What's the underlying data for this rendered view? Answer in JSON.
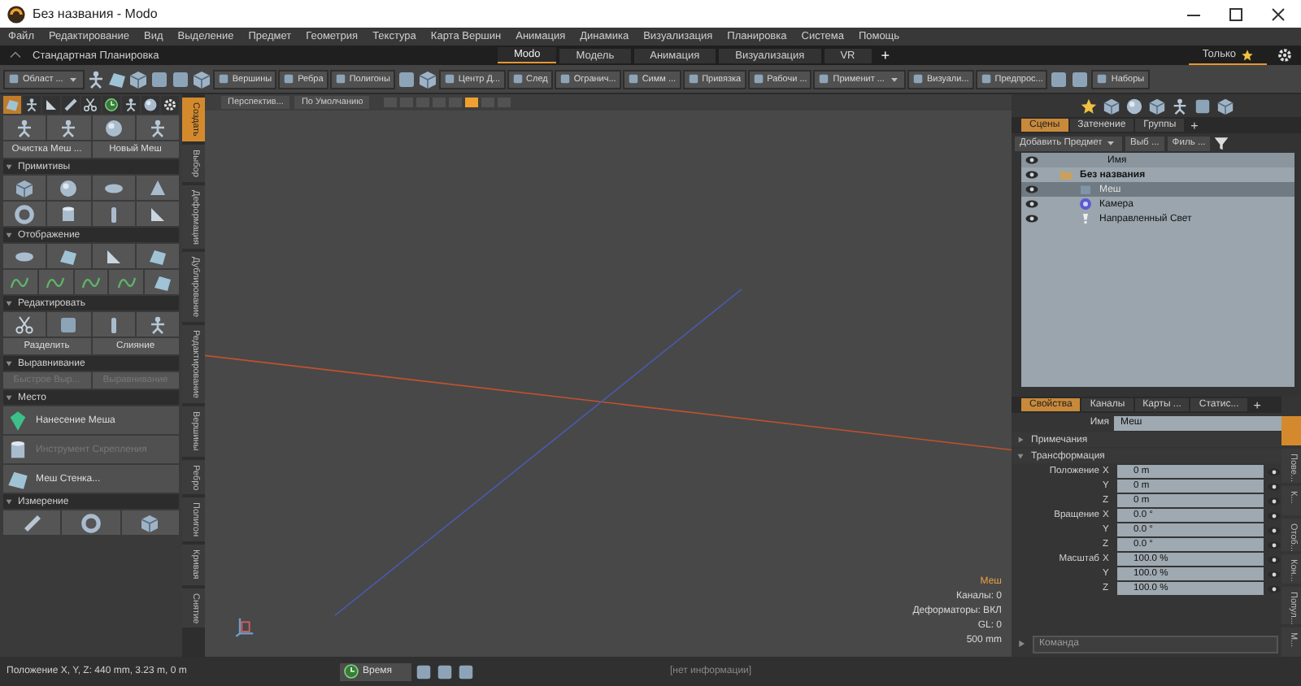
{
  "window": {
    "title": "Без названия - Modo"
  },
  "menu": [
    "Файл",
    "Редактирование",
    "Вид",
    "Выделение",
    "Предмет",
    "Геометрия",
    "Текстура",
    "Карта Вершин",
    "Анимация",
    "Динамика",
    "Визуализация",
    "Планировка",
    "Система",
    "Помощь"
  ],
  "layout_bar": {
    "layout": "Стандартная Планировка",
    "tabs": [
      {
        "label": "Modo",
        "selected": true
      },
      {
        "label": "Модель",
        "selected": false
      },
      {
        "label": "Анимация",
        "selected": false
      },
      {
        "label": "Визуализация",
        "selected": false
      },
      {
        "label": "VR",
        "selected": false
      }
    ],
    "add": "+",
    "user_tab": "Только"
  },
  "toolbar": [
    {
      "kind": "dropdown",
      "label": "Област ..."
    },
    {
      "kind": "icon"
    },
    {
      "kind": "icon"
    },
    {
      "kind": "icon"
    },
    {
      "kind": "icon"
    },
    {
      "kind": "icon"
    },
    {
      "kind": "icon"
    },
    {
      "kind": "button",
      "label": "Вершины"
    },
    {
      "kind": "button",
      "label": "Ребра"
    },
    {
      "kind": "button",
      "label": "Полигоны"
    },
    {
      "kind": "icon"
    },
    {
      "kind": "icon"
    },
    {
      "kind": "button",
      "label": "Центр Д..."
    },
    {
      "kind": "button",
      "label": "След"
    },
    {
      "kind": "button",
      "label": "Огранич..."
    },
    {
      "kind": "button",
      "label": "Симм ..."
    },
    {
      "kind": "button",
      "label": "Привязка"
    },
    {
      "kind": "button",
      "label": "Рабочи ..."
    },
    {
      "kind": "dropdown",
      "label": "Применит ..."
    },
    {
      "kind": "button",
      "label": "Визуали..."
    },
    {
      "kind": "button",
      "label": "Предпрос..."
    },
    {
      "kind": "icon"
    },
    {
      "kind": "icon"
    },
    {
      "kind": "button",
      "label": "Наборы"
    }
  ],
  "left_panel": {
    "top_buttons": [
      "Очистка Меш ...",
      "Новый Меш"
    ],
    "sections": [
      {
        "title": "Примитивы",
        "expanded": true,
        "kind": "icons"
      },
      {
        "title": "Отображение",
        "expanded": true,
        "kind": "icons"
      },
      {
        "title": "Редактировать",
        "expanded": true,
        "kind": "icons",
        "buttons": [
          {
            "label": "Разделить",
            "disabled": false
          },
          {
            "label": "Слияние",
            "disabled": false
          }
        ]
      },
      {
        "title": "Выравнивание",
        "expanded": true,
        "kind": "buttons",
        "buttons": [
          {
            "label": "Быстрое Выр...",
            "disabled": true
          },
          {
            "label": "Выравнивание",
            "disabled": true
          }
        ]
      },
      {
        "title": "Место",
        "expanded": true,
        "kind": "list",
        "buttons": [
          {
            "label": "Нанесение Меша",
            "disabled": false
          },
          {
            "label": "Инструмент Скрепления",
            "disabled": true
          },
          {
            "label": "Меш Стенка...",
            "disabled": false
          }
        ]
      },
      {
        "title": "Измерение",
        "expanded": true,
        "kind": "icons"
      }
    ]
  },
  "side_tabs": [
    {
      "label": "Создать",
      "selected": true
    },
    {
      "label": "Выбор",
      "selected": false
    },
    {
      "label": "Деформация",
      "selected": false
    },
    {
      "label": "Дублирование",
      "selected": false
    },
    {
      "label": "Редактирование",
      "selected": false
    },
    {
      "label": "Вершины",
      "selected": false
    },
    {
      "label": "Ребро",
      "selected": false
    },
    {
      "label": "Полигон",
      "selected": false
    },
    {
      "label": "Кривая",
      "selected": false
    },
    {
      "label": "Снятие",
      "selected": false
    }
  ],
  "viewport": {
    "view_buttons": [
      "Перспектив...",
      "По Умолчанию"
    ],
    "info": [
      {
        "text": "Меш",
        "kind": "title"
      },
      {
        "text": "Каналы: 0",
        "kind": "line"
      },
      {
        "text": "Деформаторы: ВКЛ",
        "kind": "line"
      },
      {
        "text": "GL: 0",
        "kind": "line"
      },
      {
        "text": "500 mm",
        "kind": "line"
      }
    ]
  },
  "scene": {
    "tabs": [
      {
        "label": "Сцены",
        "selected": true
      },
      {
        "label": "Затенение",
        "selected": false
      },
      {
        "label": "Группы",
        "selected": false
      }
    ],
    "add": "+",
    "add_item": "Добавить Предмет",
    "filters": [
      "Выб ...",
      "Филь ..."
    ],
    "column": "Имя",
    "tree": [
      {
        "name": "Без названия",
        "selected": false,
        "children": [
          {
            "name": "Меш",
            "selected": true
          },
          {
            "name": "Камера",
            "selected": false
          },
          {
            "name": "Направленный Свет",
            "selected": false
          }
        ]
      }
    ]
  },
  "properties": {
    "tabs": [
      {
        "label": "Свойства",
        "selected": true
      },
      {
        "label": "Каналы",
        "selected": false
      },
      {
        "label": "Карты ...",
        "selected": false
      },
      {
        "label": "Статис...",
        "selected": false
      }
    ],
    "add": "+",
    "name_label": "Имя",
    "name_value": "Меш",
    "sections": [
      {
        "title": "Примечания",
        "expanded": false
      },
      {
        "title": "Трансформация",
        "expanded": true
      }
    ],
    "groups": [
      {
        "label": "Положение",
        "fields": [
          {
            "axis": "X",
            "value": "0 m"
          },
          {
            "axis": "Y",
            "value": "0 m"
          },
          {
            "axis": "Z",
            "value": "0 m"
          }
        ]
      },
      {
        "label": "Вращение",
        "fields": [
          {
            "axis": "X",
            "value": "0.0 °"
          },
          {
            "axis": "Y",
            "value": "0.0 °"
          },
          {
            "axis": "Z",
            "value": "0.0 °"
          }
        ]
      },
      {
        "label": "Масштаб",
        "fields": [
          {
            "axis": "X",
            "value": "100.0 %"
          },
          {
            "axis": "Y",
            "value": "100.0 %"
          },
          {
            "axis": "Z",
            "value": "100.0 %"
          }
        ]
      }
    ],
    "side_tabs": [
      {
        "selected": true
      },
      {
        "label": "Пове...",
        "selected": false
      },
      {
        "label": "К...",
        "selected": false
      },
      {
        "label": "Отоб...",
        "selected": false
      },
      {
        "label": "Кон...",
        "selected": false
      },
      {
        "label": "Попул...",
        "selected": false
      },
      {
        "label": "М...",
        "selected": false
      }
    ],
    "command_placeholder": "Команда"
  },
  "status_bar": {
    "position": "Положение X, Y, Z:  440 mm, 3.23 m, 0 m",
    "time_button": "Время",
    "info": "[нет информации]"
  }
}
